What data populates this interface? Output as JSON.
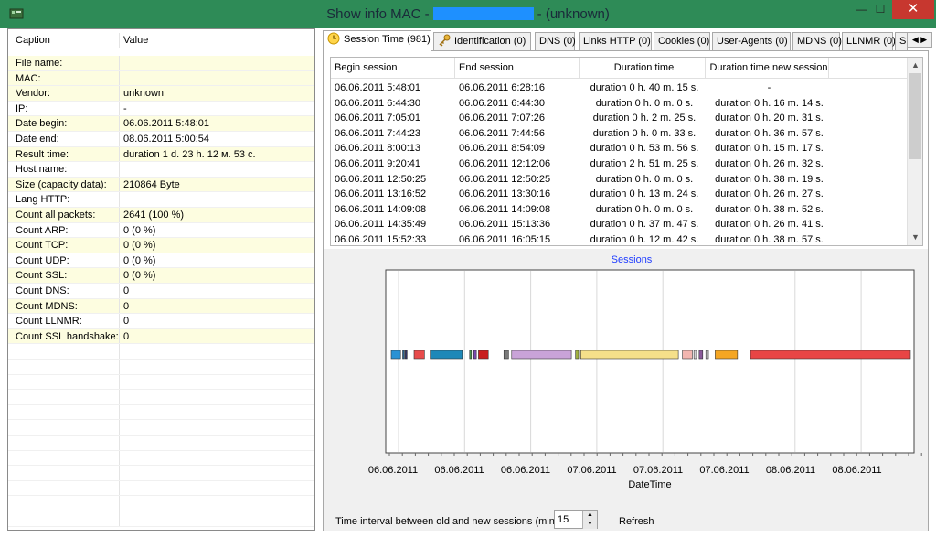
{
  "window": {
    "title_prefix": "Show info MAC  -",
    "title_suffix": "- (unknown)",
    "minimize": "—",
    "maximize": "☐",
    "close": "✕"
  },
  "grid": {
    "headers": [
      "Caption",
      "Value"
    ],
    "rows": [
      {
        "caption": "File name:",
        "value": ""
      },
      {
        "caption": "MAC:",
        "value": ""
      },
      {
        "caption": "Vendor:",
        "value": "unknown"
      },
      {
        "caption": "IP:",
        "value": "-"
      },
      {
        "caption": "Date begin:",
        "value": "06.06.2011 5:48:01"
      },
      {
        "caption": "Date end:",
        "value": "08.06.2011 5:00:54"
      },
      {
        "caption": "Result time:",
        "value": " duration 1 d. 23 h. 12 м. 53 с."
      },
      {
        "caption": "Host name:",
        "value": ""
      },
      {
        "caption": "Size (capacity data):",
        "value": "210864 Byte"
      },
      {
        "caption": "Lang HTTP:",
        "value": ""
      },
      {
        "caption": "Count all packets:",
        "value": "2641 (100 %)"
      },
      {
        "caption": "Count ARP:",
        "value": "0 (0 %)"
      },
      {
        "caption": "Count TCP:",
        "value": "0 (0 %)"
      },
      {
        "caption": "Count UDP:",
        "value": "0 (0 %)"
      },
      {
        "caption": "Count SSL:",
        "value": "0 (0 %)"
      },
      {
        "caption": "Count DNS:",
        "value": "0"
      },
      {
        "caption": "Count MDNS:",
        "value": "0"
      },
      {
        "caption": "Count LLNMR:",
        "value": "0"
      },
      {
        "caption": "Count SSL handshake:",
        "value": "0"
      }
    ]
  },
  "tabs": [
    {
      "label": "Session Time (981)",
      "icon": "clock-icon",
      "active": true
    },
    {
      "label": "Identification (0)",
      "icon": "key-icon"
    },
    {
      "label": "DNS (0)"
    },
    {
      "label": "Links HTTP (0)"
    },
    {
      "label": "Cookies (0)"
    },
    {
      "label": "User-Agents (0)"
    },
    {
      "label": "MDNS (0)"
    },
    {
      "label": "LLNMR (0)"
    },
    {
      "label": "S"
    }
  ],
  "sessions": {
    "columns": [
      "Begin session",
      "End session",
      "Duration time",
      "Duration time new session"
    ],
    "rows": [
      [
        "06.06.2011 5:48:01",
        "06.06.2011 6:28:16",
        "duration 0 h. 40 m. 15 s.",
        "-"
      ],
      [
        "06.06.2011 6:44:30",
        "06.06.2011 6:44:30",
        "duration 0 h. 0 m. 0 s.",
        "duration 0 h. 16 m. 14 s."
      ],
      [
        "06.06.2011 7:05:01",
        "06.06.2011 7:07:26",
        "duration 0 h. 2 m. 25 s.",
        "duration 0 h. 20 m. 31 s."
      ],
      [
        "06.06.2011 7:44:23",
        "06.06.2011 7:44:56",
        "duration 0 h. 0 m. 33 s.",
        "duration 0 h. 36 m. 57 s."
      ],
      [
        "06.06.2011 8:00:13",
        "06.06.2011 8:54:09",
        "duration 0 h. 53 m. 56 s.",
        "duration 0 h. 15 m. 17 s."
      ],
      [
        "06.06.2011 9:20:41",
        "06.06.2011 12:12:06",
        "duration 2 h. 51 m. 25 s.",
        "duration 0 h. 26 m. 32 s."
      ],
      [
        "06.06.2011 12:50:25",
        "06.06.2011 12:50:25",
        "duration 0 h. 0 m. 0 s.",
        "duration 0 h. 38 m. 19 s."
      ],
      [
        "06.06.2011 13:16:52",
        "06.06.2011 13:30:16",
        "duration 0 h. 13 m. 24 s.",
        "duration 0 h. 26 m. 27 s."
      ],
      [
        "06.06.2011 14:09:08",
        "06.06.2011 14:09:08",
        "duration 0 h. 0 m. 0 s.",
        "duration 0 h. 38 m. 52 s."
      ],
      [
        "06.06.2011 14:35:49",
        "06.06.2011 15:13:36",
        "duration 0 h. 37 m. 47 s.",
        "duration 0 h. 26 m. 41 s."
      ],
      [
        "06.06.2011 15:52:33",
        "06.06.2011 16:05:15",
        "duration 0 h. 12 m. 42 s.",
        "duration 0 h. 38 m. 57 s."
      ]
    ]
  },
  "chart_data": {
    "type": "bar",
    "title": "Sessions",
    "xlabel": "DateTime",
    "ylabel": "",
    "x_tick_labels": [
      "06.06.2011",
      "06.06.2011",
      "06.06.2011",
      "07.06.2011",
      "07.06.2011",
      "07.06.2011",
      "08.06.2011",
      "08.06.2011"
    ],
    "series": [
      {
        "values": [
          [
            0.0,
            0.018
          ],
          [
            0.022,
            0.025
          ],
          [
            0.027,
            0.029
          ],
          [
            0.044,
            0.064
          ],
          [
            0.075,
            0.137
          ],
          [
            0.151,
            0.154
          ],
          [
            0.159,
            0.164
          ],
          [
            0.168,
            0.187
          ],
          [
            0.217,
            0.226
          ],
          [
            0.232,
            0.347
          ],
          [
            0.355,
            0.361
          ],
          [
            0.365,
            0.553
          ],
          [
            0.561,
            0.58
          ],
          [
            0.583,
            0.588
          ],
          [
            0.593,
            0.6
          ],
          [
            0.606,
            0.611
          ],
          [
            0.624,
            0.667
          ],
          [
            0.692,
            1.0
          ]
        ],
        "colors": [
          "#2a92d4",
          "#2a5f8a",
          "#333366",
          "#e84b4b",
          "#1e88b8",
          "#4a9a4a",
          "#7a4ab0",
          "#c81e1e",
          "#7a7a7a",
          "#c9a3d8",
          "#a0b040",
          "#f5e08a",
          "#f2b6b0",
          "#cfcfcf",
          "#8a5a9a",
          "#c8c8c8",
          "#f5a623",
          "#e84545"
        ]
      }
    ],
    "x_range": [
      0,
      1
    ],
    "grid": true
  },
  "bottom": {
    "interval_label": "Time interval between old and new sessions (min):",
    "interval_value": "15",
    "refresh_label": "Refresh"
  }
}
